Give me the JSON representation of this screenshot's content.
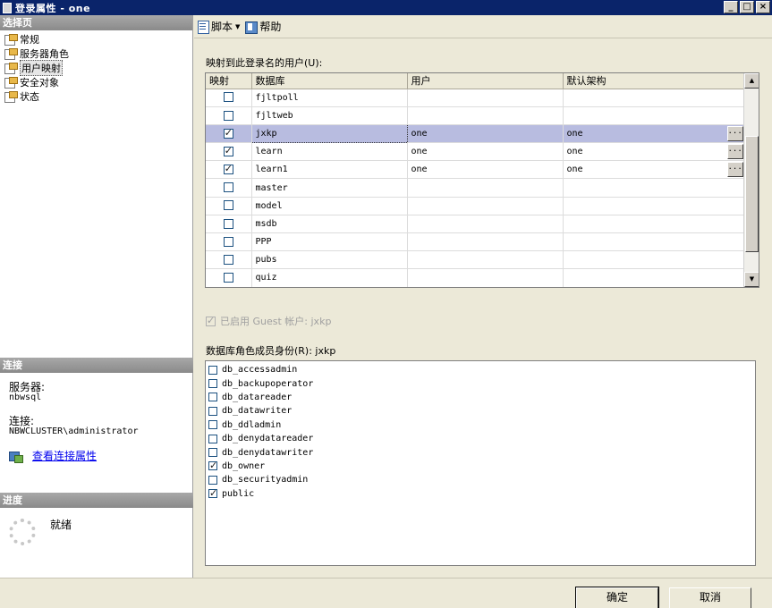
{
  "window": {
    "title": "登录属性 - one",
    "minimize": "_",
    "maximize": "□",
    "close": "×"
  },
  "toolbar": {
    "script_label": "脚本",
    "help_label": "帮助"
  },
  "left": {
    "select_page_header": "选择页",
    "pages": [
      {
        "label": "常规"
      },
      {
        "label": "服务器角色"
      },
      {
        "label": "用户映射"
      },
      {
        "label": "安全对象"
      },
      {
        "label": "状态"
      }
    ],
    "connection_header": "连接",
    "server_label": "服务器:",
    "server_value": "nbwsql",
    "connection_label": "连接:",
    "connection_value": "NBWCLUSTER\\administrator",
    "view_props_link": "查看连接属性",
    "progress_header": "进度",
    "progress_status": "就绪"
  },
  "mapping": {
    "section_label": "映射到此登录名的用户(U):",
    "columns": [
      "映射",
      "数据库",
      "用户",
      "默认架构"
    ],
    "rows": [
      {
        "mapped": false,
        "db": "fjltpoll",
        "user": "",
        "schema": ""
      },
      {
        "mapped": false,
        "db": "fjltweb",
        "user": "",
        "schema": ""
      },
      {
        "mapped": true,
        "db": "jxkp",
        "user": "one",
        "schema": "one",
        "selected": true,
        "ellipsis": "..."
      },
      {
        "mapped": true,
        "db": "learn",
        "user": "one",
        "schema": "one",
        "ellipsis": "..."
      },
      {
        "mapped": true,
        "db": "learn1",
        "user": "one",
        "schema": "one",
        "ellipsis": "..."
      },
      {
        "mapped": false,
        "db": "master",
        "user": "",
        "schema": ""
      },
      {
        "mapped": false,
        "db": "model",
        "user": "",
        "schema": ""
      },
      {
        "mapped": false,
        "db": "msdb",
        "user": "",
        "schema": ""
      },
      {
        "mapped": false,
        "db": "PPP",
        "user": "",
        "schema": ""
      },
      {
        "mapped": false,
        "db": "pubs",
        "user": "",
        "schema": ""
      },
      {
        "mapped": false,
        "db": "quiz",
        "user": "",
        "schema": ""
      }
    ]
  },
  "guest": {
    "label": "已启用 Guest 帐户: jxkp",
    "checked": true
  },
  "roles": {
    "section_label": "数据库角色成员身份(R): jxkp",
    "items": [
      {
        "name": "db_accessadmin",
        "checked": false
      },
      {
        "name": "db_backupoperator",
        "checked": false
      },
      {
        "name": "db_datareader",
        "checked": false
      },
      {
        "name": "db_datawriter",
        "checked": false
      },
      {
        "name": "db_ddladmin",
        "checked": false
      },
      {
        "name": "db_denydatareader",
        "checked": false
      },
      {
        "name": "db_denydatawriter",
        "checked": false
      },
      {
        "name": "db_owner",
        "checked": true
      },
      {
        "name": "db_securityadmin",
        "checked": false
      },
      {
        "name": "public",
        "checked": true
      }
    ]
  },
  "buttons": {
    "ok": "确定",
    "cancel": "取消"
  }
}
